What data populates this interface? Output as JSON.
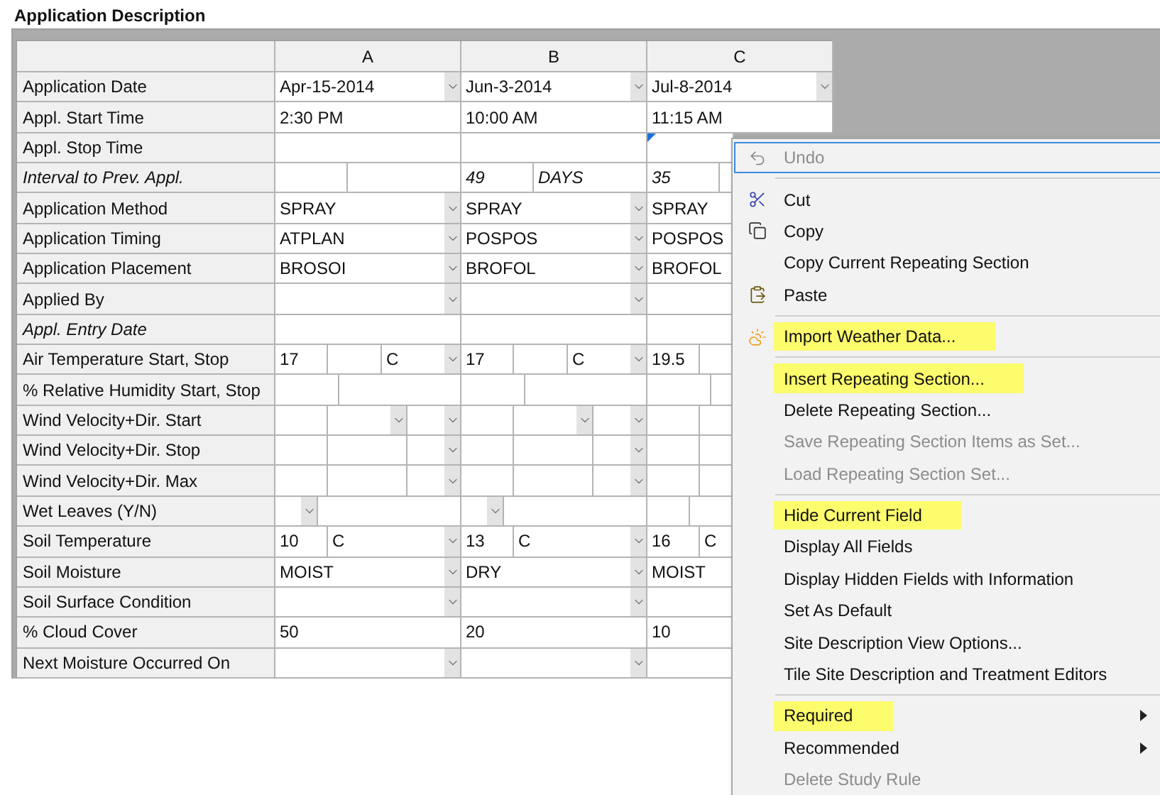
{
  "section_title": "Application Description",
  "grid": {
    "columns": [
      "A",
      "B",
      "C"
    ],
    "rows": [
      {
        "label": "Application Date",
        "italic": false,
        "kind": "dropdown",
        "cells": [
          {
            "value": "Apr-15-2014",
            "focused": false
          },
          {
            "value": "Jun-3-2014",
            "focused": false
          },
          {
            "value": "Jul-8-2014",
            "focused": false
          }
        ]
      },
      {
        "label": "Appl. Start Time",
        "italic": false,
        "kind": "text",
        "cells": [
          {
            "value": "2:30 PM",
            "focused": false
          },
          {
            "value": "10:00 AM",
            "focused": false
          },
          {
            "value": "11:15 AM",
            "focused": false
          }
        ]
      },
      {
        "label": "Appl. Stop Time",
        "italic": false,
        "kind": "text",
        "cells": [
          {
            "focused": false
          },
          {
            "focused": false
          },
          {
            "focused": true
          }
        ]
      },
      {
        "label": "Interval to Prev. Appl.",
        "italic": true,
        "kind": "interval",
        "cells": [
          {
            "focused": false
          },
          {
            "number": "49",
            "unit": "DAYS",
            "focused": false
          },
          {
            "number": "35",
            "focused": false
          }
        ]
      },
      {
        "label": "Application Method",
        "italic": false,
        "kind": "dropdown",
        "cells": [
          {
            "value": "SPRAY",
            "focused": false
          },
          {
            "value": "SPRAY",
            "focused": false
          },
          {
            "value": "SPRAY",
            "focused": false
          }
        ]
      },
      {
        "label": "Application Timing",
        "italic": false,
        "kind": "dropdown",
        "cells": [
          {
            "value": "ATPLAN",
            "focused": false
          },
          {
            "value": "POSPOS",
            "focused": false
          },
          {
            "value": "POSPOS",
            "focused": false
          }
        ]
      },
      {
        "label": "Application Placement",
        "italic": false,
        "kind": "dropdown",
        "cells": [
          {
            "value": "BROSOI",
            "focused": false
          },
          {
            "value": "BROFOL",
            "focused": false
          },
          {
            "value": "BROFOL",
            "focused": false
          }
        ]
      },
      {
        "label": "Applied By",
        "italic": false,
        "kind": "dropdown",
        "cells": [
          {
            "focused": false
          },
          {
            "focused": false
          },
          {
            "focused": false
          }
        ]
      },
      {
        "label": "Appl. Entry Date",
        "italic": true,
        "kind": "text",
        "cells": [
          {
            "focused": false
          },
          {
            "focused": false
          },
          {
            "focused": false
          }
        ]
      },
      {
        "label": "Air Temperature Start, Stop",
        "italic": false,
        "kind": "temp",
        "cells": [
          {
            "start": "17",
            "unit": "C",
            "focused": false
          },
          {
            "start": "17",
            "unit": "C",
            "focused": false
          },
          {
            "start": "19.5",
            "focused": false
          }
        ]
      },
      {
        "label": "% Relative Humidity Start, Stop",
        "italic": false,
        "kind": "pair",
        "cells": [
          {
            "focused": false
          },
          {
            "focused": false
          },
          {
            "focused": false
          }
        ]
      },
      {
        "label": "Wind Velocity+Dir. Start",
        "italic": false,
        "kind": "wind_start",
        "cells": [
          {
            "focused": false
          },
          {
            "focused": false
          },
          {
            "focused": false
          }
        ]
      },
      {
        "label": "Wind Velocity+Dir. Stop",
        "italic": false,
        "kind": "wind",
        "cells": [
          {
            "focused": false
          },
          {
            "focused": false
          },
          {
            "focused": false
          }
        ]
      },
      {
        "label": "Wind Velocity+Dir. Max",
        "italic": false,
        "kind": "wind",
        "cells": [
          {
            "focused": false
          },
          {
            "focused": false
          },
          {
            "focused": false
          }
        ]
      },
      {
        "label": "Wet Leaves (Y/N)",
        "italic": false,
        "kind": "yn",
        "cells": [
          {
            "focused": false
          },
          {
            "focused": false
          },
          {
            "focused": false
          }
        ]
      },
      {
        "label": "Soil Temperature",
        "italic": false,
        "kind": "value_unit",
        "cells": [
          {
            "value": "10",
            "unit": "C",
            "focused": false
          },
          {
            "value": "13",
            "unit": "C",
            "focused": false
          },
          {
            "value": "16",
            "unit": "C",
            "focused": false
          }
        ]
      },
      {
        "label": "Soil Moisture",
        "italic": false,
        "kind": "dropdown",
        "cells": [
          {
            "value": "MOIST",
            "focused": false
          },
          {
            "value": "DRY",
            "focused": false
          },
          {
            "value": "MOIST",
            "focused": false
          }
        ]
      },
      {
        "label": "Soil Surface Condition",
        "italic": false,
        "kind": "dropdown",
        "cells": [
          {
            "focused": false
          },
          {
            "focused": false
          },
          {
            "focused": false
          }
        ]
      },
      {
        "label": "% Cloud Cover",
        "italic": false,
        "kind": "text",
        "cells": [
          {
            "value": "50",
            "focused": false
          },
          {
            "value": "20",
            "focused": false
          },
          {
            "value": "10",
            "focused": false
          }
        ]
      },
      {
        "label": "Next Moisture Occurred On",
        "italic": false,
        "kind": "dropdown",
        "cells": [
          {
            "focused": false
          },
          {
            "focused": false
          },
          {
            "focused": false
          }
        ]
      }
    ]
  },
  "context_menu": {
    "items": [
      {
        "kind": "item",
        "label": "Undo",
        "disabled": true,
        "focused": true,
        "highlighted": false,
        "submenu": false
      },
      {
        "kind": "separator"
      },
      {
        "kind": "item",
        "label": "Cut",
        "disabled": false,
        "focused": false,
        "highlighted": false,
        "submenu": false
      },
      {
        "kind": "item",
        "label": "Copy",
        "disabled": false,
        "focused": false,
        "highlighted": false,
        "submenu": false
      },
      {
        "kind": "item",
        "label": "Copy Current Repeating Section",
        "disabled": false,
        "focused": false,
        "highlighted": false,
        "submenu": false
      },
      {
        "kind": "item",
        "label": "Paste",
        "disabled": false,
        "focused": false,
        "highlighted": false,
        "submenu": false
      },
      {
        "kind": "separator"
      },
      {
        "kind": "item",
        "label": "Import Weather Data...",
        "disabled": false,
        "focused": false,
        "highlighted": true,
        "submenu": false
      },
      {
        "kind": "separator"
      },
      {
        "kind": "item",
        "label": "Insert Repeating Section...",
        "disabled": false,
        "focused": false,
        "highlighted": true,
        "submenu": false
      },
      {
        "kind": "item",
        "label": "Delete Repeating Section...",
        "disabled": false,
        "focused": false,
        "highlighted": false,
        "submenu": false
      },
      {
        "kind": "item",
        "label": "Save Repeating Section Items as Set...",
        "disabled": true,
        "focused": false,
        "highlighted": false,
        "submenu": false
      },
      {
        "kind": "item",
        "label": "Load Repeating Section Set...",
        "disabled": true,
        "focused": false,
        "highlighted": false,
        "submenu": false
      },
      {
        "kind": "separator"
      },
      {
        "kind": "item",
        "label": "Hide Current Field",
        "disabled": false,
        "focused": false,
        "highlighted": true,
        "submenu": false
      },
      {
        "kind": "item",
        "label": "Display All Fields",
        "disabled": false,
        "focused": false,
        "highlighted": false,
        "submenu": false
      },
      {
        "kind": "item",
        "label": "Display Hidden Fields with Information",
        "disabled": false,
        "focused": false,
        "highlighted": false,
        "submenu": false
      },
      {
        "kind": "item",
        "label": "Set As Default",
        "disabled": false,
        "focused": false,
        "highlighted": false,
        "submenu": false
      },
      {
        "kind": "item",
        "label": "Site Description View Options...",
        "disabled": false,
        "focused": false,
        "highlighted": false,
        "submenu": false
      },
      {
        "kind": "item",
        "label": "Tile Site Description and Treatment Editors",
        "disabled": false,
        "focused": false,
        "highlighted": false,
        "submenu": false
      },
      {
        "kind": "separator"
      },
      {
        "kind": "item",
        "label": "Required",
        "disabled": false,
        "focused": false,
        "highlighted": true,
        "submenu": true
      },
      {
        "kind": "item",
        "label": "Recommended",
        "disabled": false,
        "focused": false,
        "highlighted": false,
        "submenu": true
      },
      {
        "kind": "item",
        "label": "Delete Study Rule",
        "disabled": true,
        "focused": false,
        "highlighted": false,
        "submenu": false
      }
    ]
  }
}
